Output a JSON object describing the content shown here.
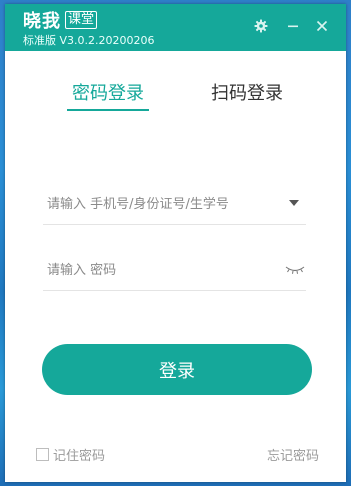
{
  "titlebar": {
    "logo_text": "晓我",
    "logo_box_text": "课堂",
    "version": "标准版 V3.0.2.20200206",
    "background_color": "#15a89a"
  },
  "tabs": [
    {
      "label": "密码登录",
      "active": true
    },
    {
      "label": "扫码登录",
      "active": false
    }
  ],
  "form": {
    "account_placeholder": "请输入 手机号/身份证号/生学号",
    "password_placeholder": "请输入 密码",
    "login_label": "登录",
    "remember_label": "记住密码",
    "forgot_label": "忘记密码"
  },
  "icons": {
    "settings": "gear-icon",
    "minimize": "minimize-icon",
    "close": "close-icon",
    "dropdown": "triangle-down-icon",
    "password_visibility": "eye-closed-icon"
  },
  "accent_color": "#15a89a"
}
